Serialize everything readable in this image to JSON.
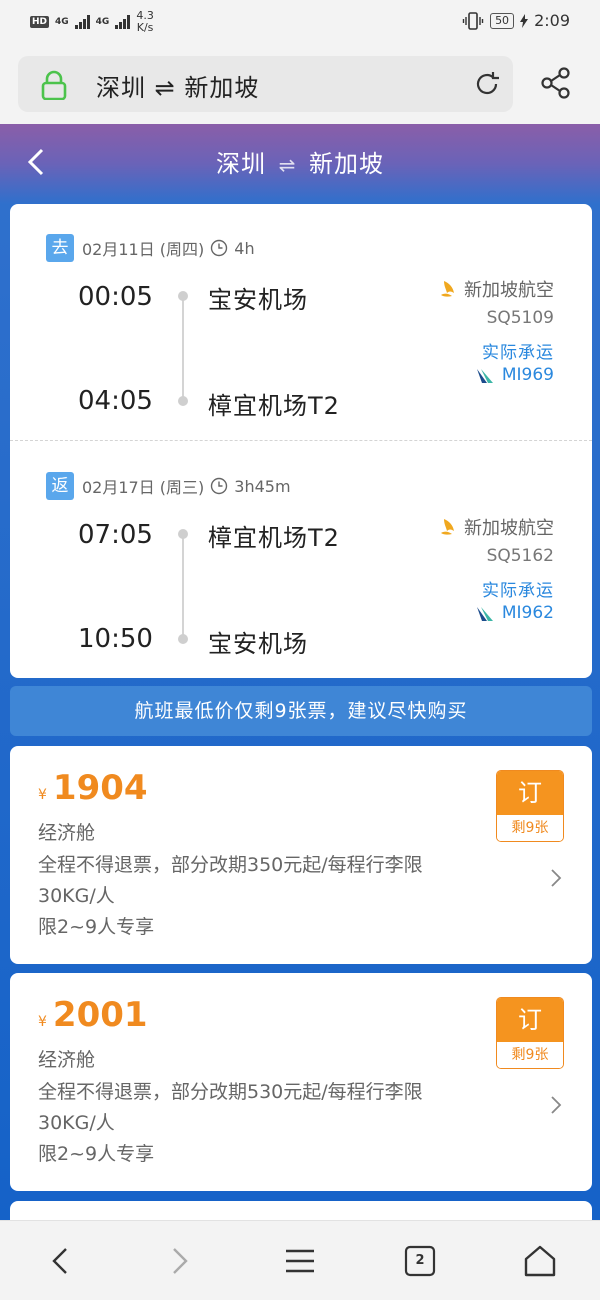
{
  "status_bar": {
    "hd": "HD",
    "net1": "4G",
    "net2": "4G",
    "speed": "4.3",
    "speed_unit": "K/s",
    "battery": "50",
    "time": "2:09"
  },
  "browser": {
    "url_text": "深圳 ⇌ 新加坡"
  },
  "header": {
    "from": "深圳",
    "to": "新加坡",
    "arrow": "⇌"
  },
  "outbound": {
    "tag": "去",
    "date": "02月11日 (周四)",
    "duration": "4h",
    "dep_time": "00:05",
    "arr_time": "04:05",
    "dep_airport": "宝安机场",
    "arr_airport": "樟宜机场T2",
    "airline": "新加坡航空",
    "flight_no": "SQ5109",
    "actual_label": "实际承运",
    "operating_flight": "MI969"
  },
  "return": {
    "tag": "返",
    "date": "02月17日 (周三)",
    "duration": "3h45m",
    "dep_time": "07:05",
    "arr_time": "10:50",
    "dep_airport": "樟宜机场T2",
    "arr_airport": "宝安机场",
    "airline": "新加坡航空",
    "flight_no": "SQ5162",
    "actual_label": "实际承运",
    "operating_flight": "MI962"
  },
  "notice": "航班最低价仅剩9张票，建议尽快购买",
  "fares": [
    {
      "currency": "¥",
      "price": "1904",
      "cabin": "经济舱",
      "rule": "全程不得退票，部分改期350元起/每程行李限30KG/人",
      "limit": "限2~9人专享",
      "book": "订",
      "remaining": "剩9张"
    },
    {
      "currency": "¥",
      "price": "2001",
      "cabin": "经济舱",
      "rule": "全程不得退票，部分改期530元起/每程行李限30KG/人",
      "limit": "限2~9人专享",
      "book": "订",
      "remaining": "剩9张"
    }
  ],
  "bottom_nav": {
    "tab_count": "2"
  },
  "colors": {
    "accent_orange": "#f08a1f",
    "link_blue": "#2a88de",
    "background_blue": "#1a63c8"
  }
}
